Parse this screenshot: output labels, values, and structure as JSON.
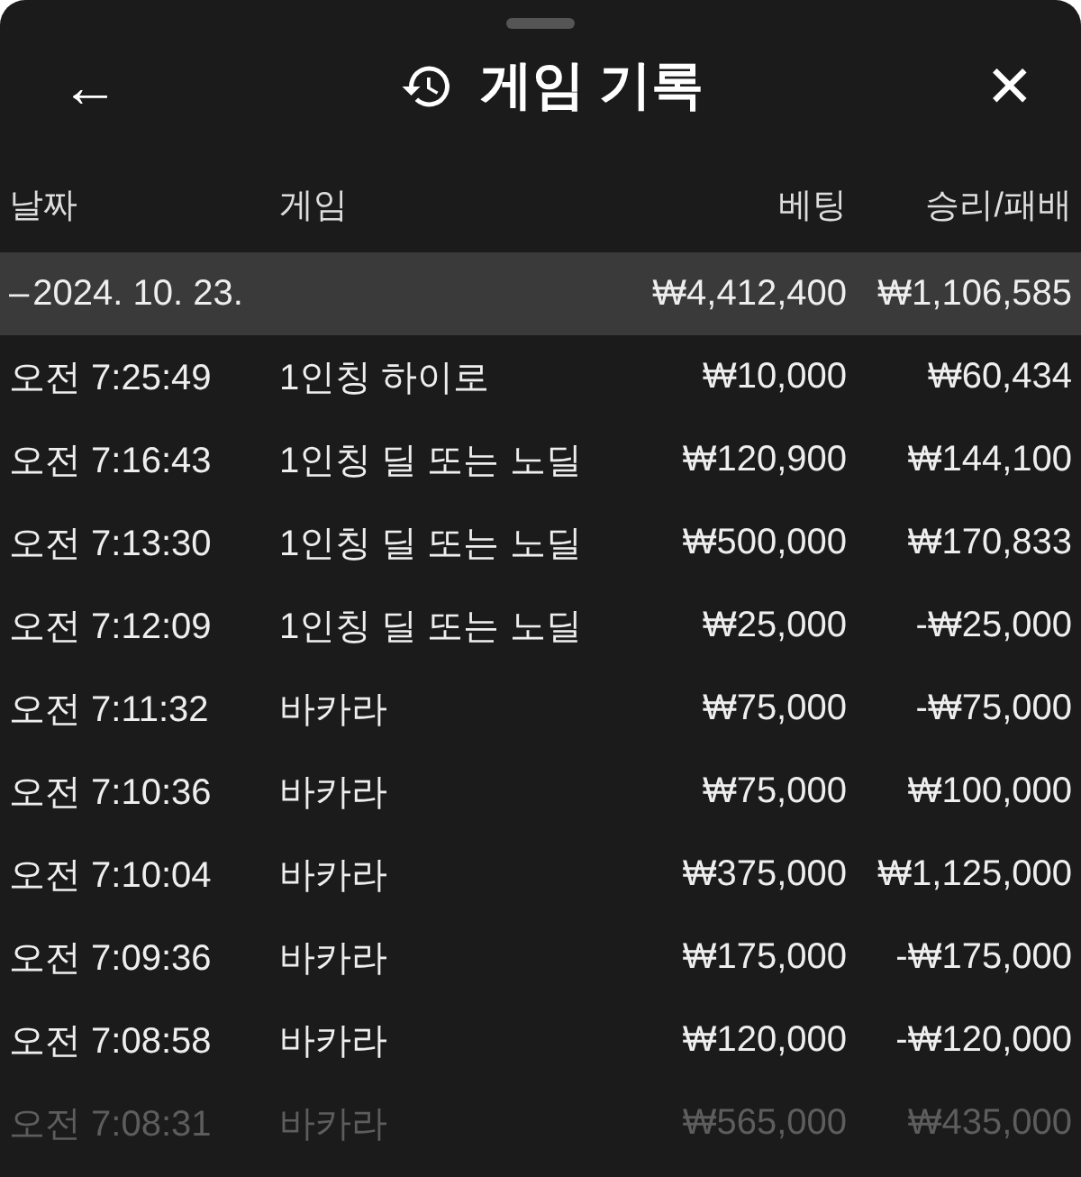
{
  "header": {
    "back": "←",
    "title": "게임 기록",
    "close": "✕"
  },
  "columns": [
    "날짜",
    "게임",
    "베팅",
    "승리/패배"
  ],
  "group": {
    "collapse": "–",
    "date": "2024. 10. 23.",
    "bet": "₩4,412,400",
    "result": "₩1,106,585"
  },
  "rows": [
    {
      "time": "오전 7:25:49",
      "game": "1인칭 하이로",
      "bet": "₩10,000",
      "result": "₩60,434",
      "dimmed": false
    },
    {
      "time": "오전 7:16:43",
      "game": "1인칭 딜 또는 노딜",
      "bet": "₩120,900",
      "result": "₩144,100",
      "dimmed": false
    },
    {
      "time": "오전 7:13:30",
      "game": "1인칭 딜 또는 노딜",
      "bet": "₩500,000",
      "result": "₩170,833",
      "dimmed": false
    },
    {
      "time": "오전 7:12:09",
      "game": "1인칭 딜 또는 노딜",
      "bet": "₩25,000",
      "result": "-₩25,000",
      "dimmed": false
    },
    {
      "time": "오전 7:11:32",
      "game": "바카라",
      "bet": "₩75,000",
      "result": "-₩75,000",
      "dimmed": false
    },
    {
      "time": "오전 7:10:36",
      "game": "바카라",
      "bet": "₩75,000",
      "result": "₩100,000",
      "dimmed": false
    },
    {
      "time": "오전 7:10:04",
      "game": "바카라",
      "bet": "₩375,000",
      "result": "₩1,125,000",
      "dimmed": false
    },
    {
      "time": "오전 7:09:36",
      "game": "바카라",
      "bet": "₩175,000",
      "result": "-₩175,000",
      "dimmed": false
    },
    {
      "time": "오전 7:08:58",
      "game": "바카라",
      "bet": "₩120,000",
      "result": "-₩120,000",
      "dimmed": false
    },
    {
      "time": "오전 7:08:31",
      "game": "바카라",
      "bet": "₩565,000",
      "result": "₩435,000",
      "dimmed": true
    }
  ]
}
